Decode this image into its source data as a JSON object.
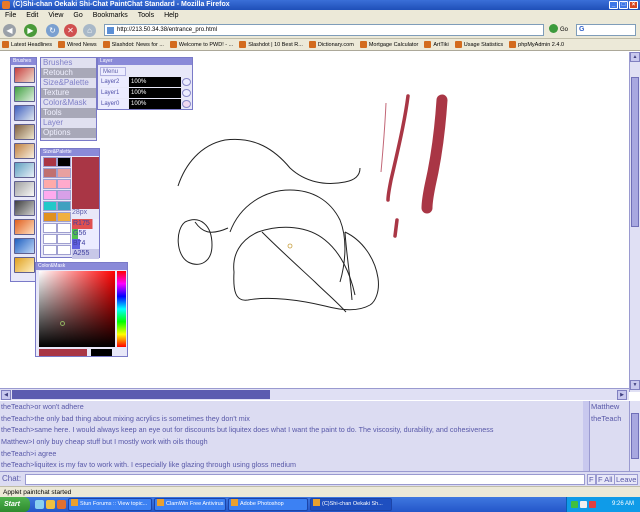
{
  "window": {
    "title": "(C)Shi-chan Oekaki Shi-Chat PaintChat Standard - Mozilla Firefox",
    "buttons": [
      "_",
      "□",
      "×"
    ]
  },
  "menu": [
    "File",
    "Edit",
    "View",
    "Go",
    "Bookmarks",
    "Tools",
    "Help"
  ],
  "nav": {
    "url": "http://213.50.34.38/entrance_pro.html",
    "go_label": "Go"
  },
  "bookmarks": [
    "Latest Headlines",
    "Wired News",
    "Slashdot: News for ...",
    "Welcome to PWD! - ...",
    "Slashdot | 10 Best R...",
    "Dictionary.com",
    "Mortgage Calculator",
    "ArtTiki",
    "Usage Statistics",
    "phpMyAdmin 2.4.0"
  ],
  "palettes": {
    "tools_title": "Brushes",
    "menu_items": [
      "Brushes",
      "Retouch",
      "Size&Palette",
      "Texture",
      "Color&Mask",
      "Tools",
      "Layer",
      "Options"
    ],
    "layer": {
      "title": "Layer",
      "menu_label": "Menu",
      "rows": [
        {
          "name": "Layer2",
          "opacity": "100%"
        },
        {
          "name": "Layer1",
          "opacity": "100%"
        },
        {
          "name": "Layer0",
          "opacity": "100%"
        }
      ]
    },
    "size": {
      "title": "Size&Palette",
      "brush_size": "28px",
      "r": "R175",
      "g": "G56",
      "b": "B74",
      "a": "A255"
    },
    "color": {
      "title": "Color&Mask"
    }
  },
  "colors": {
    "current": "#a93645",
    "palette_left": [
      "#a93645",
      "#c07070",
      "#ffaaaa",
      "#ffaaee",
      "#22c8c8",
      "#e09020",
      "#ffffff",
      "#ffffff",
      "#ffffff"
    ],
    "palette_right": [
      "#000000",
      "#e8a0a0",
      "#ffaacc",
      "#d8a0e8",
      "#40a0c0",
      "#f0b040",
      "#ffffff",
      "#ffffff",
      "#ffffff"
    ]
  },
  "chat": {
    "lines": [
      "theTeach>or won't adhere",
      "theTeach>the only bad thing about mixing acrylics is sometimes they don't mix",
      "theTeach>same here. I would always keep an eye out for discounts but liquitex does what I want the paint to do. The viscosity, durability, and cohesiveness",
      "Matthew>I only buy cheap stuff but I mostly work with oils though",
      "theTeach>i agree",
      "theTeach>liquitex is my fav to work with. I especially like glazing through using gloss medium"
    ],
    "users": [
      "Matthew",
      "theTeach"
    ],
    "input_label": "Chat:",
    "buttons": [
      "F",
      "F All",
      "Leave"
    ]
  },
  "status": "Applet paintchat started",
  "taskbar": {
    "start": "Start",
    "tasks": [
      "Stun Forums :: View topic...",
      "ClamWin Free Antivirus",
      "Adobe Photoshop",
      "(C)Shi-chan Oekaki Sh..."
    ],
    "time": "9:26 AM"
  }
}
